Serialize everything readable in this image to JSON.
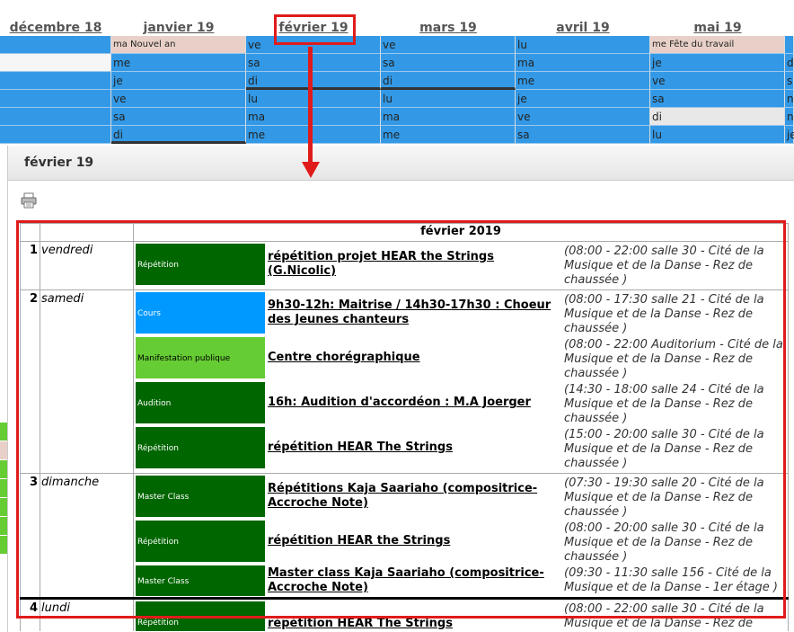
{
  "months": [
    "décembre 18",
    "janvier 19",
    "février 19",
    "mars 19",
    "avril 19",
    "mai 19"
  ],
  "grid": {
    "rows": [
      [
        "",
        "ma Nouvel an",
        "ve",
        "ve",
        "lu",
        "me Fête du travail",
        ""
      ],
      [
        "",
        "me",
        "sa",
        "sa",
        "ma",
        "je",
        "d"
      ],
      [
        "",
        "je",
        "di",
        "di",
        "me",
        "ve",
        "s"
      ],
      [
        "",
        "ve",
        "lu",
        "lu",
        "je",
        "sa",
        "n"
      ],
      [
        "",
        "sa",
        "ma",
        "ma",
        "ve",
        "di",
        "n"
      ],
      [
        "",
        "di",
        "me",
        "me",
        "sa",
        "lu",
        "je"
      ]
    ]
  },
  "popup": {
    "title": "février 19",
    "table_header": "février 2019",
    "days": [
      {
        "num": "1",
        "name": "vendredi"
      },
      {
        "num": "2",
        "name": "samedi"
      },
      {
        "num": "3",
        "name": "dimanche"
      },
      {
        "num": "4",
        "name": "lundi"
      }
    ],
    "events": [
      {
        "type": "Répétition",
        "title": "répétition projet HEAR the Strings (G.Nicolic)",
        "detail": "(08:00 - 22:00 salle 30 - Cité de la Musique et de la Danse - Rez de chaussée )"
      },
      {
        "type": "Cours",
        "title": "9h30-12h: Maitrise / 14h30-17h30 : Choeur des Jeunes chanteurs",
        "detail": "(08:00 - 17:30 salle 21 - Cité de la Musique et de la Danse - Rez de chaussée )"
      },
      {
        "type": "Manifestation publique",
        "title": "Centre chorégraphique",
        "detail": "(08:00 - 22:00 Auditorium - Cité de la Musique et de la Danse - Rez de chaussée )"
      },
      {
        "type": "Audition",
        "title": "16h: Audition d'accordéon : M.A Joerger",
        "detail": "(14:30 - 18:00 salle 24 - Cité de la Musique et de la Danse - Rez de chaussée )"
      },
      {
        "type": "Répétition",
        "title": "répétition HEAR The Strings",
        "detail": "(15:00 - 20:00 salle 30 - Cité de la Musique et de la Danse - Rez de chaussée )"
      },
      {
        "type": "Master Class",
        "title": "Répétitions Kaja Saariaho (compositrice-Accroche Note)",
        "detail": "(07:30 - 19:30 salle 20 - Cité de la Musique et de la Danse - Rez de chaussée )"
      },
      {
        "type": "Répétition",
        "title": "répétition HEAR the Strings",
        "detail": "(08:00 - 20:00 salle 30 - Cité de la Musique et de la Danse - Rez de chaussée )"
      },
      {
        "type": "Master Class",
        "title": "Master class Kaja Saariaho (compositrice-Accroche Note)",
        "detail": "(09:30 - 11:30 salle 156 - Cité de la Musique et de la Danse - 1er étage )"
      },
      {
        "type": "Répétition",
        "title": "répétition HEAR The Strings",
        "detail": "(08:00 - 22:00 salle 30 - Cité de la Musique et de la Danse - Rez de"
      }
    ]
  },
  "colors": {
    "grid_blue": "#3399e6",
    "rehearsal": "#006600",
    "course": "#0099ff",
    "public_event": "#66cc33",
    "annotation_red": "#e01b1b"
  }
}
